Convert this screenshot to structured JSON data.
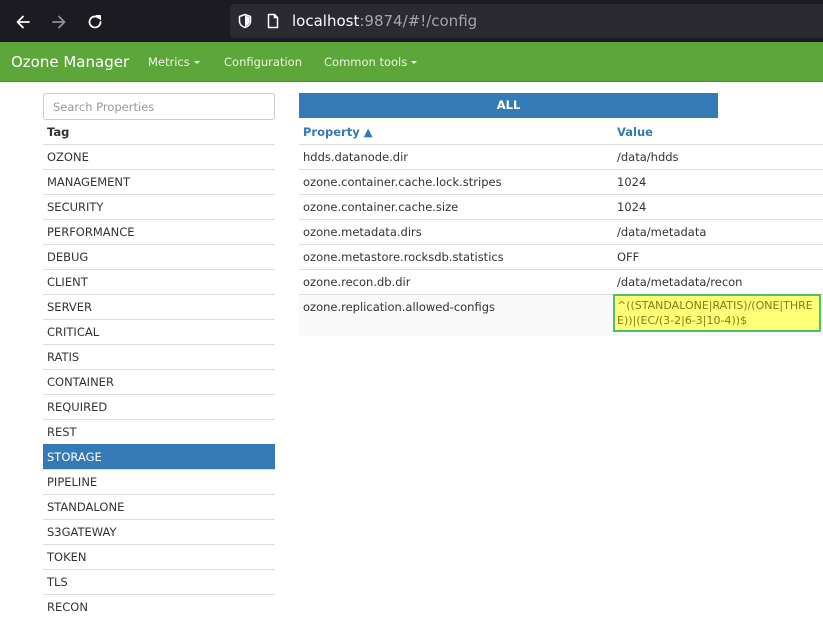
{
  "browser": {
    "back_icon": "arrow-left-icon",
    "forward_icon": "arrow-right-icon",
    "reload_icon": "reload-icon",
    "url_host": "localhost",
    "url_rest": ":9874/#!/config"
  },
  "navbar": {
    "brand": "Ozone Manager",
    "links": [
      {
        "label": "Metrics",
        "dropdown": true
      },
      {
        "label": "Configuration",
        "dropdown": false
      },
      {
        "label": "Common tools",
        "dropdown": true
      }
    ],
    "bg_color": "#5da639"
  },
  "search": {
    "placeholder": "Search Properties"
  },
  "tags": {
    "header": "Tag",
    "items": [
      "OZONE",
      "MANAGEMENT",
      "SECURITY",
      "PERFORMANCE",
      "DEBUG",
      "CLIENT",
      "SERVER",
      "CRITICAL",
      "RATIS",
      "CONTAINER",
      "REQUIRED",
      "REST",
      "STORAGE",
      "PIPELINE",
      "STANDALONE",
      "S3GATEWAY",
      "TOKEN",
      "TLS",
      "RECON"
    ],
    "selected": "STORAGE"
  },
  "filter_button": "ALL",
  "table": {
    "col_property": "Property ▲",
    "col_value": "Value",
    "rows": [
      {
        "name": "hdds.datanode.dir",
        "value": "/data/hdds"
      },
      {
        "name": "ozone.container.cache.lock.stripes",
        "value": "1024"
      },
      {
        "name": "ozone.container.cache.size",
        "value": "1024"
      },
      {
        "name": "ozone.metadata.dirs",
        "value": "/data/metadata"
      },
      {
        "name": "ozone.metastore.rocksdb.statistics",
        "value": "OFF"
      },
      {
        "name": "ozone.recon.db.dir",
        "value": "/data/metadata/recon"
      },
      {
        "name": "ozone.replication.allowed-configs",
        "value": "^((STANDALONE|RATIS)/(ONE|THREE))|(EC/(3-2|6-3|10-4))$",
        "highlighted": true
      }
    ]
  },
  "accent_color": "#337ab7"
}
